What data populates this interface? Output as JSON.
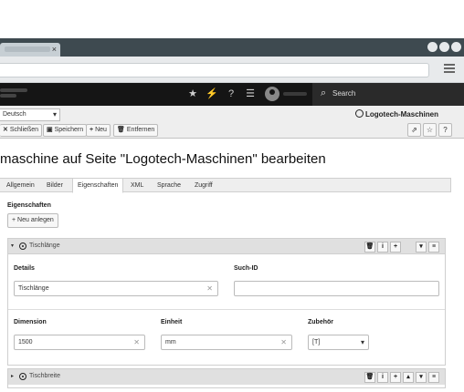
{
  "browser": {
    "tab_close": "×"
  },
  "topbar": {
    "search_label": "Search",
    "icons": [
      "star-icon",
      "bolt-icon",
      "help-icon",
      "list-icon",
      "avatar",
      "search-icon"
    ]
  },
  "docheader": {
    "language": "Deutsch",
    "page_crumb": "Logotech-Maschinen",
    "buttons": {
      "close": "Schließen",
      "save": "Speichern",
      "new": "Neu",
      "remove": "Entfernen"
    },
    "right_icons": [
      "external-link-icon",
      "star-outline-icon",
      "help-icon"
    ],
    "help_glyph": "?"
  },
  "page": {
    "title": "maschine auf Seite \"Logotech-Maschinen\" bearbeiten"
  },
  "tabs": [
    {
      "label": "Allgemein"
    },
    {
      "label": "Bilder"
    },
    {
      "label": "Eigenschaften",
      "active": true
    },
    {
      "label": "XML"
    },
    {
      "label": "Sprache"
    },
    {
      "label": "Zugriff"
    }
  ],
  "properties": {
    "section_label": "Eigenschaften",
    "new_button": "Neu anlegen",
    "panels": [
      {
        "title": "Tischlänge",
        "expanded": true,
        "details_label": "Details",
        "details_value": "Tischlänge",
        "search_id_label": "Such-ID",
        "search_id_value": "",
        "dimension_label": "Dimension",
        "dimension_value": "1500",
        "unit_label": "Einheit",
        "unit_value": "mm",
        "addition_label": "Zubehör",
        "addition_value": "[T]"
      },
      {
        "title": "Tischbreite",
        "expanded": false
      }
    ],
    "control_glyphs": {
      "info": "i",
      "add": "+"
    }
  },
  "colors": {
    "topbar": "#151515",
    "tabbar": "#3e4a50",
    "docheader": "#eeeeee",
    "panel_header": "#e0e0e0"
  }
}
